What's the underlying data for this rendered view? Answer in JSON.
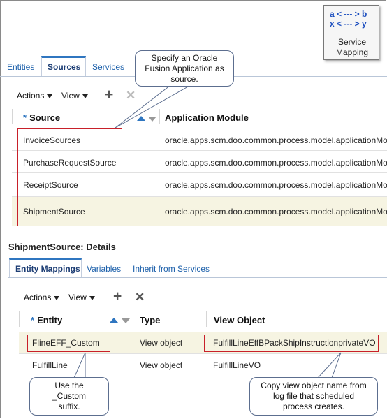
{
  "service_icon": {
    "line1": "a < --- > b",
    "line2": "x < --- > y",
    "caption1": "Service",
    "caption2": "Mapping"
  },
  "tabs": [
    {
      "label": "Entities"
    },
    {
      "label": "Sources"
    },
    {
      "label": "Services"
    }
  ],
  "callouts": {
    "source": "Specify an Oracle Fusion Application as source.",
    "source_l1": "Specify an Oracle",
    "source_l2": "Fusion Application as",
    "source_l3": "source.",
    "custom_l1": "Use the",
    "custom_l2": "_Custom",
    "custom_l3": "suffix.",
    "vo_l1": "Copy view object name from",
    "vo_l2": "log file that scheduled",
    "vo_l3": "process creates."
  },
  "toolbar": {
    "actions": "Actions",
    "view": "View",
    "add_icon": "+",
    "delete_icon": "✕"
  },
  "sources_table": {
    "col_source": "Source",
    "col_module": "Application Module",
    "required_mark": "*",
    "rows": [
      {
        "source": "InvoiceSources",
        "module": "oracle.apps.scm.doo.common.process.model.applicationModule"
      },
      {
        "source": "PurchaseRequestSource",
        "module": "oracle.apps.scm.doo.common.process.model.applicationModule"
      },
      {
        "source": "ReceiptSource",
        "module": "oracle.apps.scm.doo.common.process.model.applicationModule"
      },
      {
        "source": "ShipmentSource",
        "module": "oracle.apps.scm.doo.common.process.model.applicationModule"
      }
    ]
  },
  "details": {
    "title": "ShipmentSource: Details",
    "subtabs": [
      {
        "label": "Entity Mappings"
      },
      {
        "label": "Variables"
      },
      {
        "label": "Inherit from Services"
      }
    ],
    "col_entity": "Entity",
    "col_type": "Type",
    "col_vo": "View Object",
    "rows": [
      {
        "entity": "FlineEFF_Custom",
        "type": "View object",
        "vo": "FulfillLineEffBPackShipInstructionprivateVO"
      },
      {
        "entity": "FulfillLine",
        "type": "View object",
        "vo": "FulfillLineVO"
      }
    ]
  }
}
